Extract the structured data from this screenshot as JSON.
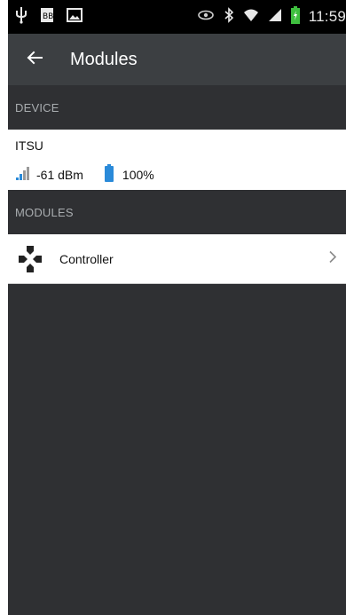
{
  "status_bar": {
    "time": "11:59",
    "icons": [
      "usb-icon",
      "bbm-icon",
      "image-icon",
      "eye-icon",
      "bluetooth-icon",
      "wifi-icon",
      "cell-signal-icon",
      "battery-charging-icon"
    ]
  },
  "app_bar": {
    "title": "Modules",
    "back_icon": "arrow-left-icon"
  },
  "device_section": {
    "header": "DEVICE",
    "device": {
      "name": "ITSU",
      "signal": "-61 dBm",
      "battery": "100%"
    }
  },
  "modules_section": {
    "header": "MODULES",
    "items": [
      {
        "label": "Controller",
        "icon": "gamepad-icon"
      }
    ]
  },
  "colors": {
    "background": "#2f3033",
    "app_bar": "#3c3f42",
    "accent_blue": "#2a8ad9"
  }
}
